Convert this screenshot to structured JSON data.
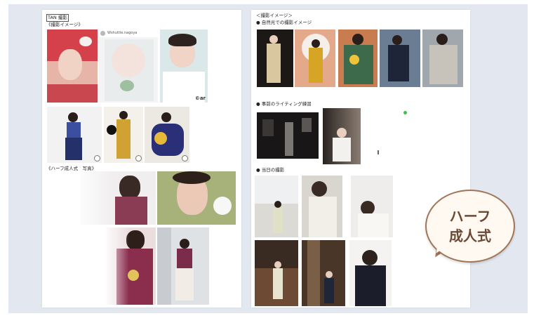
{
  "left_doc": {
    "header_label": "TAN 撮影",
    "section_image": "《撮影イメージ》",
    "section_half": "《ハーフ成人式　写真》",
    "ig_account": "Wshuttle.nagoya",
    "watermark": "©ar"
  },
  "right_doc": {
    "section_image": "＜撮影イメージ＞",
    "section_nature": "● 自然光での撮影イメージ",
    "section_lighting": "● 事前のライティング練習",
    "section_day": "● 当日の撮影"
  },
  "badge": {
    "line1": "ハーフ",
    "line2": "成人式"
  },
  "colors": {
    "frame_bg": "#e3e8f0",
    "badge_border": "#a07558",
    "badge_text": "#6b4a35",
    "marker_green": "#3bc24a"
  }
}
